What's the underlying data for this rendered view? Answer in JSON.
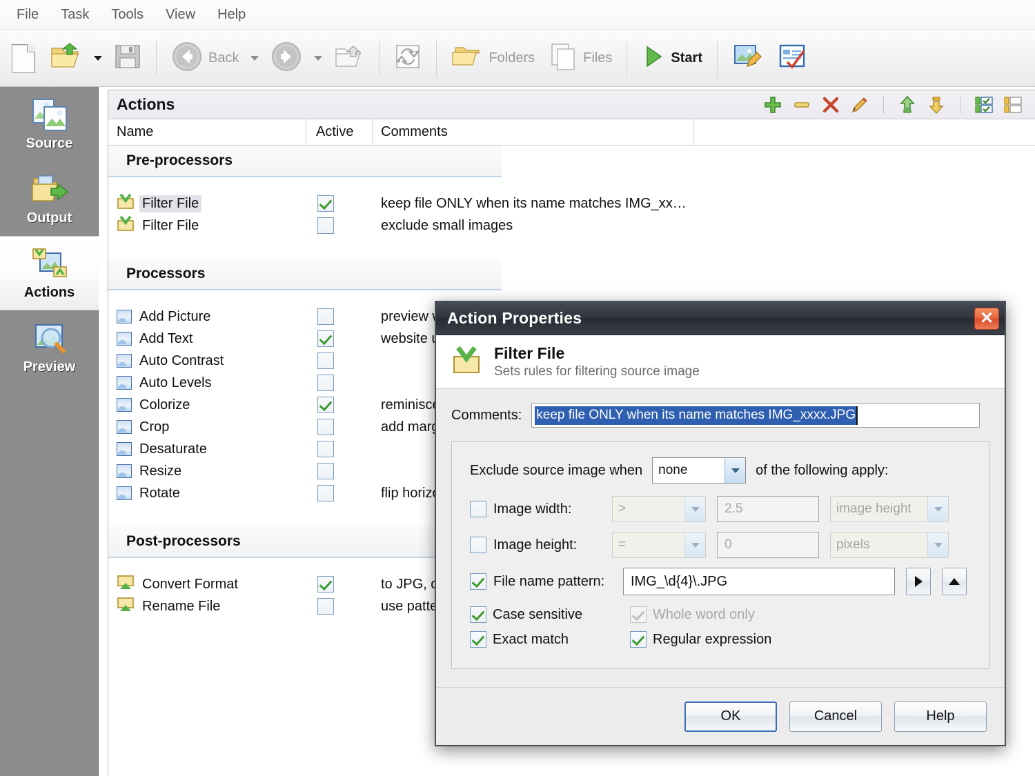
{
  "menu": {
    "items": [
      "File",
      "Task",
      "Tools",
      "View",
      "Help"
    ]
  },
  "toolbar": {
    "new_label": "",
    "open_label": "",
    "save_label": "",
    "back_label": "Back",
    "forward_label": "",
    "up_label": "",
    "refresh_label": "",
    "folders_label": "Folders",
    "files_label": "Files",
    "start_label": "Start",
    "edit_image_label": "",
    "options_label": ""
  },
  "sidebar": {
    "items": [
      {
        "label": "Source",
        "icon": "source-images-icon",
        "active": false
      },
      {
        "label": "Output",
        "icon": "output-folder-icon",
        "active": false
      },
      {
        "label": "Actions",
        "icon": "actions-icon",
        "active": true
      },
      {
        "label": "Preview",
        "icon": "preview-magnifier-icon",
        "active": false
      }
    ]
  },
  "panel": {
    "title": "Actions",
    "tools": [
      {
        "name": "add-action-button",
        "glyph": "+"
      },
      {
        "name": "remove-action-button",
        "glyph": "–"
      },
      {
        "name": "delete-action-button",
        "glyph": "✕"
      },
      {
        "name": "edit-action-button",
        "glyph": "✎"
      },
      {
        "name": "move-up-button",
        "glyph": "↑"
      },
      {
        "name": "move-down-button",
        "glyph": "↓"
      },
      {
        "name": "check-all-button",
        "glyph": "☑"
      },
      {
        "name": "uncheck-all-button",
        "glyph": "☐"
      }
    ],
    "columns": [
      "Name",
      "Active",
      "Comments"
    ],
    "groups": [
      {
        "title": "Pre-processors",
        "icon_kind": "filter",
        "rows": [
          {
            "name": "Filter File",
            "active": true,
            "comment": "keep file ONLY when its name matches IMG_xx…",
            "selected": true
          },
          {
            "name": "Filter File",
            "active": false,
            "comment": "exclude small images",
            "selected": false
          }
        ]
      },
      {
        "title": "Processors",
        "icon_kind": "processor",
        "rows": [
          {
            "name": "Add Picture",
            "active": false,
            "comment": "preview w",
            "selected": false
          },
          {
            "name": "Add Text",
            "active": true,
            "comment": "website u",
            "selected": false
          },
          {
            "name": "Auto Contrast",
            "active": false,
            "comment": "",
            "selected": false
          },
          {
            "name": "Auto Levels",
            "active": false,
            "comment": "",
            "selected": false
          },
          {
            "name": "Colorize",
            "active": true,
            "comment": "reminisce",
            "selected": false
          },
          {
            "name": "Crop",
            "active": false,
            "comment": "add marg",
            "selected": false
          },
          {
            "name": "Desaturate",
            "active": false,
            "comment": "",
            "selected": false
          },
          {
            "name": "Resize",
            "active": false,
            "comment": "",
            "selected": false
          },
          {
            "name": "Rotate",
            "active": false,
            "comment": "flip horizo",
            "selected": false
          }
        ]
      },
      {
        "title": "Post-processors",
        "icon_kind": "postprocessor",
        "rows": [
          {
            "name": "Convert Format",
            "active": true,
            "comment": "to JPG, q",
            "selected": false
          },
          {
            "name": "Rename File",
            "active": false,
            "comment": "use patte",
            "selected": false
          }
        ]
      }
    ]
  },
  "dialog": {
    "title": "Action Properties",
    "close_glyph": "✕",
    "header_title": "Filter File",
    "header_subtitle": "Sets rules for filtering source image",
    "comments_label": "Comments:",
    "comments_value": "keep file ONLY when its name matches IMG_xxxx.JPG",
    "exclude_prefix": "Exclude source image when",
    "exclude_mode": "none",
    "exclude_suffix": "of the following apply:",
    "conditions": [
      {
        "label": "Image width:",
        "checked": false,
        "enabled": false,
        "operator": ">",
        "value": "2.5",
        "unit": "image height"
      },
      {
        "label": "Image height:",
        "checked": false,
        "enabled": false,
        "operator": "=",
        "value": "0",
        "unit": "pixels"
      }
    ],
    "pattern": {
      "label": "File name pattern:",
      "checked": true,
      "value": "IMG_\\d{4}\\.JPG",
      "menu_button_glyph": "▶",
      "history_button_glyph": "▲"
    },
    "options": [
      {
        "label": "Case sensitive",
        "checked": true,
        "enabled": true
      },
      {
        "label": "Whole word only",
        "checked": true,
        "enabled": false
      },
      {
        "label": "Exact match",
        "checked": true,
        "enabled": true
      },
      {
        "label": "Regular expression",
        "checked": true,
        "enabled": true
      }
    ],
    "buttons": [
      {
        "label": "OK",
        "default": true
      },
      {
        "label": "Cancel",
        "default": false
      },
      {
        "label": "Help",
        "default": false
      }
    ]
  },
  "colors": {
    "accent_blue": "#2f5fb0",
    "title_dark": "#2f343d",
    "close_red": "#d7482a",
    "check_green": "#3d9b2f",
    "sidebar_gray": "#8c8c8c"
  }
}
